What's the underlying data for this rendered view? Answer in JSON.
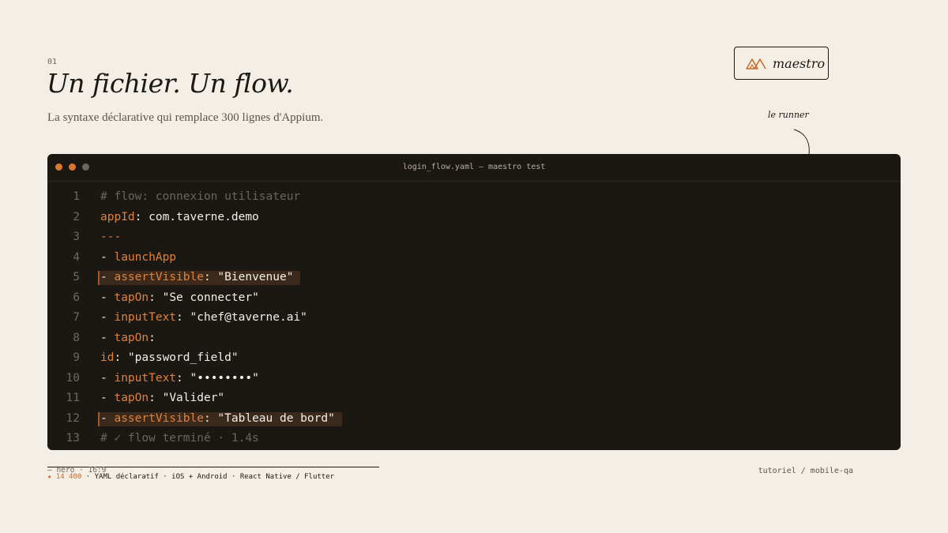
{
  "slide": {
    "number": "01",
    "title": "Un fichier. Un flow.",
    "subtitle": "La syntaxe déclarative qui remplace 300 lignes d'Appium."
  },
  "badge": {
    "label": "maestro",
    "logo_icon": "mountain-logo-icon"
  },
  "annotation": {
    "text": "le runner"
  },
  "window": {
    "title": "login_flow.yaml — maestro test",
    "traffic_lights": [
      "#d9772f",
      "#d9772f",
      "#6b655c"
    ]
  },
  "code": {
    "lines": [
      {
        "n": "1",
        "parts": [
          {
            "t": "# flow: connexion utilisateur",
            "s": "c"
          }
        ]
      },
      {
        "n": "2",
        "parts": [
          {
            "t": "appId",
            "s": "k"
          },
          {
            "t": ": com.taverne.demo",
            "s": "w"
          }
        ]
      },
      {
        "n": "3",
        "parts": [
          {
            "t": "---",
            "s": "k"
          }
        ]
      },
      {
        "n": "4",
        "parts": [
          {
            "t": "- ",
            "s": "w"
          },
          {
            "t": "launchApp",
            "s": "k"
          }
        ]
      },
      {
        "n": "5",
        "highlight": true,
        "parts": [
          {
            "t": "- ",
            "s": "w"
          },
          {
            "t": "assertVisible",
            "s": "k"
          },
          {
            "t": ": \"Bienvenue\"",
            "s": "w"
          }
        ]
      },
      {
        "n": "6",
        "parts": [
          {
            "t": "- ",
            "s": "w"
          },
          {
            "t": "tapOn",
            "s": "k"
          },
          {
            "t": ": \"Se connecter\"",
            "s": "w"
          }
        ]
      },
      {
        "n": "7",
        "parts": [
          {
            "t": "- ",
            "s": "w"
          },
          {
            "t": "inputText",
            "s": "k"
          },
          {
            "t": ": \"chef@taverne.ai\"",
            "s": "w"
          }
        ]
      },
      {
        "n": "8",
        "parts": [
          {
            "t": "- ",
            "s": "w"
          },
          {
            "t": "tapOn",
            "s": "k"
          },
          {
            "t": ":",
            "s": "w"
          }
        ]
      },
      {
        "n": "9",
        "parts": [
          {
            "t": "id",
            "s": "k"
          },
          {
            "t": ": \"password_field\"",
            "s": "w"
          }
        ]
      },
      {
        "n": "10",
        "parts": [
          {
            "t": "- ",
            "s": "w"
          },
          {
            "t": "inputText",
            "s": "k"
          },
          {
            "t": ": \"••••••••\"",
            "s": "w"
          }
        ]
      },
      {
        "n": "11",
        "parts": [
          {
            "t": "- ",
            "s": "w"
          },
          {
            "t": "tapOn",
            "s": "k"
          },
          {
            "t": ": \"Valider\"",
            "s": "w"
          }
        ]
      },
      {
        "n": "12",
        "highlight": true,
        "parts": [
          {
            "t": "- ",
            "s": "w"
          },
          {
            "t": "assertVisible",
            "s": "k"
          },
          {
            "t": ": \"Tableau de bord\"",
            "s": "w"
          }
        ]
      },
      {
        "n": "13",
        "parts": [
          {
            "t": "# ✓ flow terminé · 1.4s",
            "s": "c"
          }
        ]
      }
    ]
  },
  "footer": {
    "tag": "— hero · 16:9",
    "stars": "★ 14 400",
    "platforms": " · YAML déclaratif · iOS + Android · React Native / Flutter",
    "breadcrumb": "tutoriel / mobile-qa"
  },
  "colors": {
    "background": "#f4efe6",
    "accent": "#e0813a",
    "editor_bg": "#1b1814",
    "ink": "#1c1813"
  }
}
